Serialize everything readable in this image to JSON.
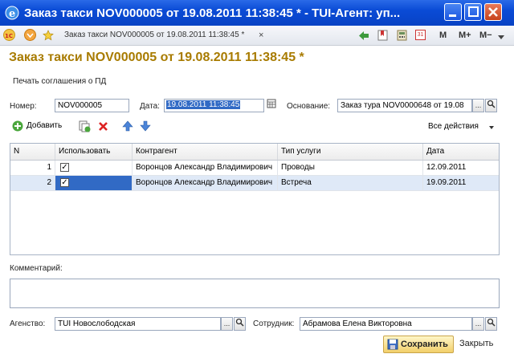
{
  "window": {
    "title": "Заказ такси NOV000005 от 19.08.2011 11:38:45 * - TUI-Агент: уп..."
  },
  "toolbar": {
    "doc_title": "Заказ такси NOV000005 от 19.08.2011 11:38:45 *",
    "close_mark": "×",
    "m_label": "M",
    "mplus_label": "M+",
    "mminus_label": "M−",
    "calendar_label": "31"
  },
  "form": {
    "title": "Заказ такси NOV000005 от 19.08.2011 11:38:45 *",
    "print_link": "Печать соглашения о ПД",
    "number_label": "Номер:",
    "number_value": "NOV000005",
    "date_label": "Дата:",
    "date_value": "19.08.2011 11:38:45",
    "basis_label": "Основание:",
    "basis_value": "Заказ тура NOV0000648 от 19.08"
  },
  "actions": {
    "add_label": "Добавить",
    "all_actions_label": "Все действия"
  },
  "table": {
    "columns": [
      "N",
      "Использовать",
      "Контрагент",
      "Тип услуги",
      "Дата"
    ],
    "rows": [
      {
        "n": "1",
        "use": "✓",
        "counterparty": "Воронцов Александр Владимирович",
        "service": "Проводы",
        "date": "12.09.2011"
      },
      {
        "n": "2",
        "use": "✓",
        "counterparty": "Воронцов Александр Владимирович",
        "service": "Встреча",
        "date": "19.09.2011"
      }
    ]
  },
  "footer": {
    "comment_label": "Комментарий:",
    "agency_label": "Агенство:",
    "agency_value": "TUI Новослободская",
    "employee_label": "Сотрудник:",
    "employee_value": "Абрамова Елена Викторовна",
    "save_label": "Сохранить",
    "close_label": "Закрыть"
  },
  "colors": {
    "title_gold": "#a87b00",
    "selection_blue": "#316ac5",
    "selected_row": "#dfe9f7"
  }
}
